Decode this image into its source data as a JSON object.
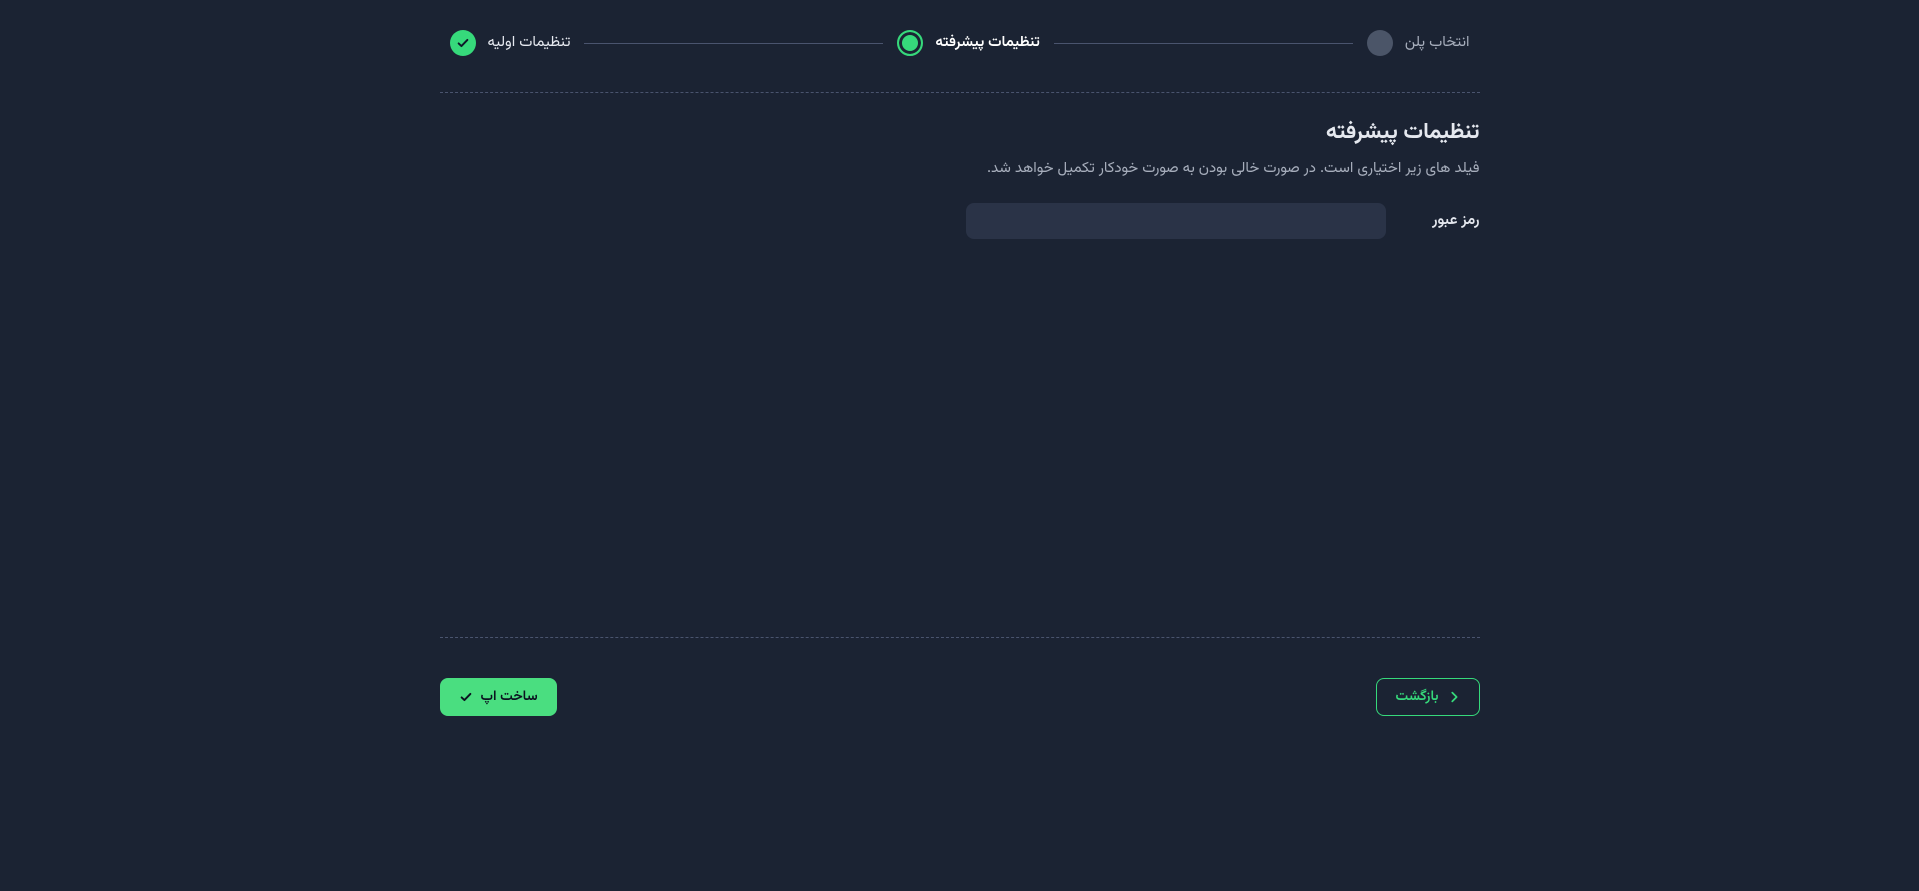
{
  "stepper": {
    "steps": [
      {
        "label": "تنظیمات اولیه",
        "state": "completed"
      },
      {
        "label": "تنظیمات پیشرفته",
        "state": "current"
      },
      {
        "label": "انتخاب پلن",
        "state": "pending"
      }
    ]
  },
  "content": {
    "title": "تنظیمات پیشرفته",
    "subtitle": "فیلد های زیر اختیاری است. در صورت خالی بودن به صورت خودکار تکمیل خواهد شد.",
    "password": {
      "label": "رمز عبور",
      "value": "",
      "placeholder": ""
    }
  },
  "footer": {
    "back_label": "بازگشت",
    "submit_label": "ساخت اپ"
  },
  "colors": {
    "accent": "#36d97b",
    "background": "#1b2333",
    "panel": "#2a3347"
  }
}
